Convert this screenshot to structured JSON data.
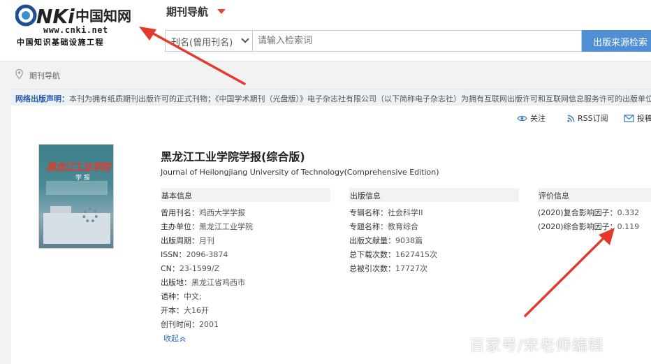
{
  "header": {
    "logo_url": "www.cnki.net",
    "logo_brand": "CNKI中国知网",
    "logo_tagline": "中国知识基础设施工程",
    "nav_title": "期刊导航"
  },
  "search": {
    "select_value": "刊名(曾用刊名)",
    "placeholder": "请输入检索词",
    "button_label": "出版来源检索"
  },
  "breadcrumb": {
    "label": "期刊导航"
  },
  "notice": {
    "label": "网络出版声明：",
    "text": "本刊为拥有纸质期刊出版许可的正式刊物；《中国学术期刊（光盘版）》电子杂志社有限公司（以下简称电子杂志社）为拥有互联网出版许可和互联网信息服务许可的出版单位..."
  },
  "actions": {
    "follow": "关注",
    "rss": "RSS订阅",
    "submit": "投稿"
  },
  "journal": {
    "title": "黑龙江工业学院学报(综合版)",
    "title_en": "Journal of Heilongjiang University of Technology(Comprehensive Edition)",
    "cover_title": "黑龙江工业学院",
    "cover_sub": "学 报"
  },
  "basic_info": {
    "heading": "基本信息",
    "fields": [
      {
        "label": "曾用刊名：",
        "value": "鸡西大学学报"
      },
      {
        "label": "主办单位：",
        "value": "黑龙江工业学院"
      },
      {
        "label": "出版周期：",
        "value": "月刊"
      },
      {
        "label": "ISSN：",
        "value": "2096-3874"
      },
      {
        "label": "CN：",
        "value": "23-1599/Z"
      },
      {
        "label": "出版地：",
        "value": "黑龙江省鸡西市"
      },
      {
        "label": "语种：",
        "value": "中文;"
      },
      {
        "label": "开本：",
        "value": "大16开"
      },
      {
        "label": "创刊时间：",
        "value": "2001"
      }
    ],
    "collapse_label": "收起"
  },
  "pub_info": {
    "heading": "出版信息",
    "fields": [
      {
        "label": "专辑名称：",
        "value": "社会科学II"
      },
      {
        "label": "专题名称：",
        "value": "教育综合"
      },
      {
        "label": "出版文献量：",
        "value": "9038篇"
      },
      {
        "label": "总下载次数：",
        "value": "1627415次"
      },
      {
        "label": "总被引次数：",
        "value": "17727次"
      }
    ]
  },
  "eval_info": {
    "heading": "评价信息",
    "fields": [
      {
        "label": "(2020)复合影响因子：",
        "value": "0.332"
      },
      {
        "label": "(2020)综合影响因子：",
        "value": "0.119"
      }
    ]
  },
  "watermark": "百家号/宋老师编辑",
  "colors": {
    "accent_blue": "#4f8fd6",
    "link_blue": "#2a6cc0",
    "arrow_red": "#e5392b",
    "caret_red": "#e8453c"
  }
}
